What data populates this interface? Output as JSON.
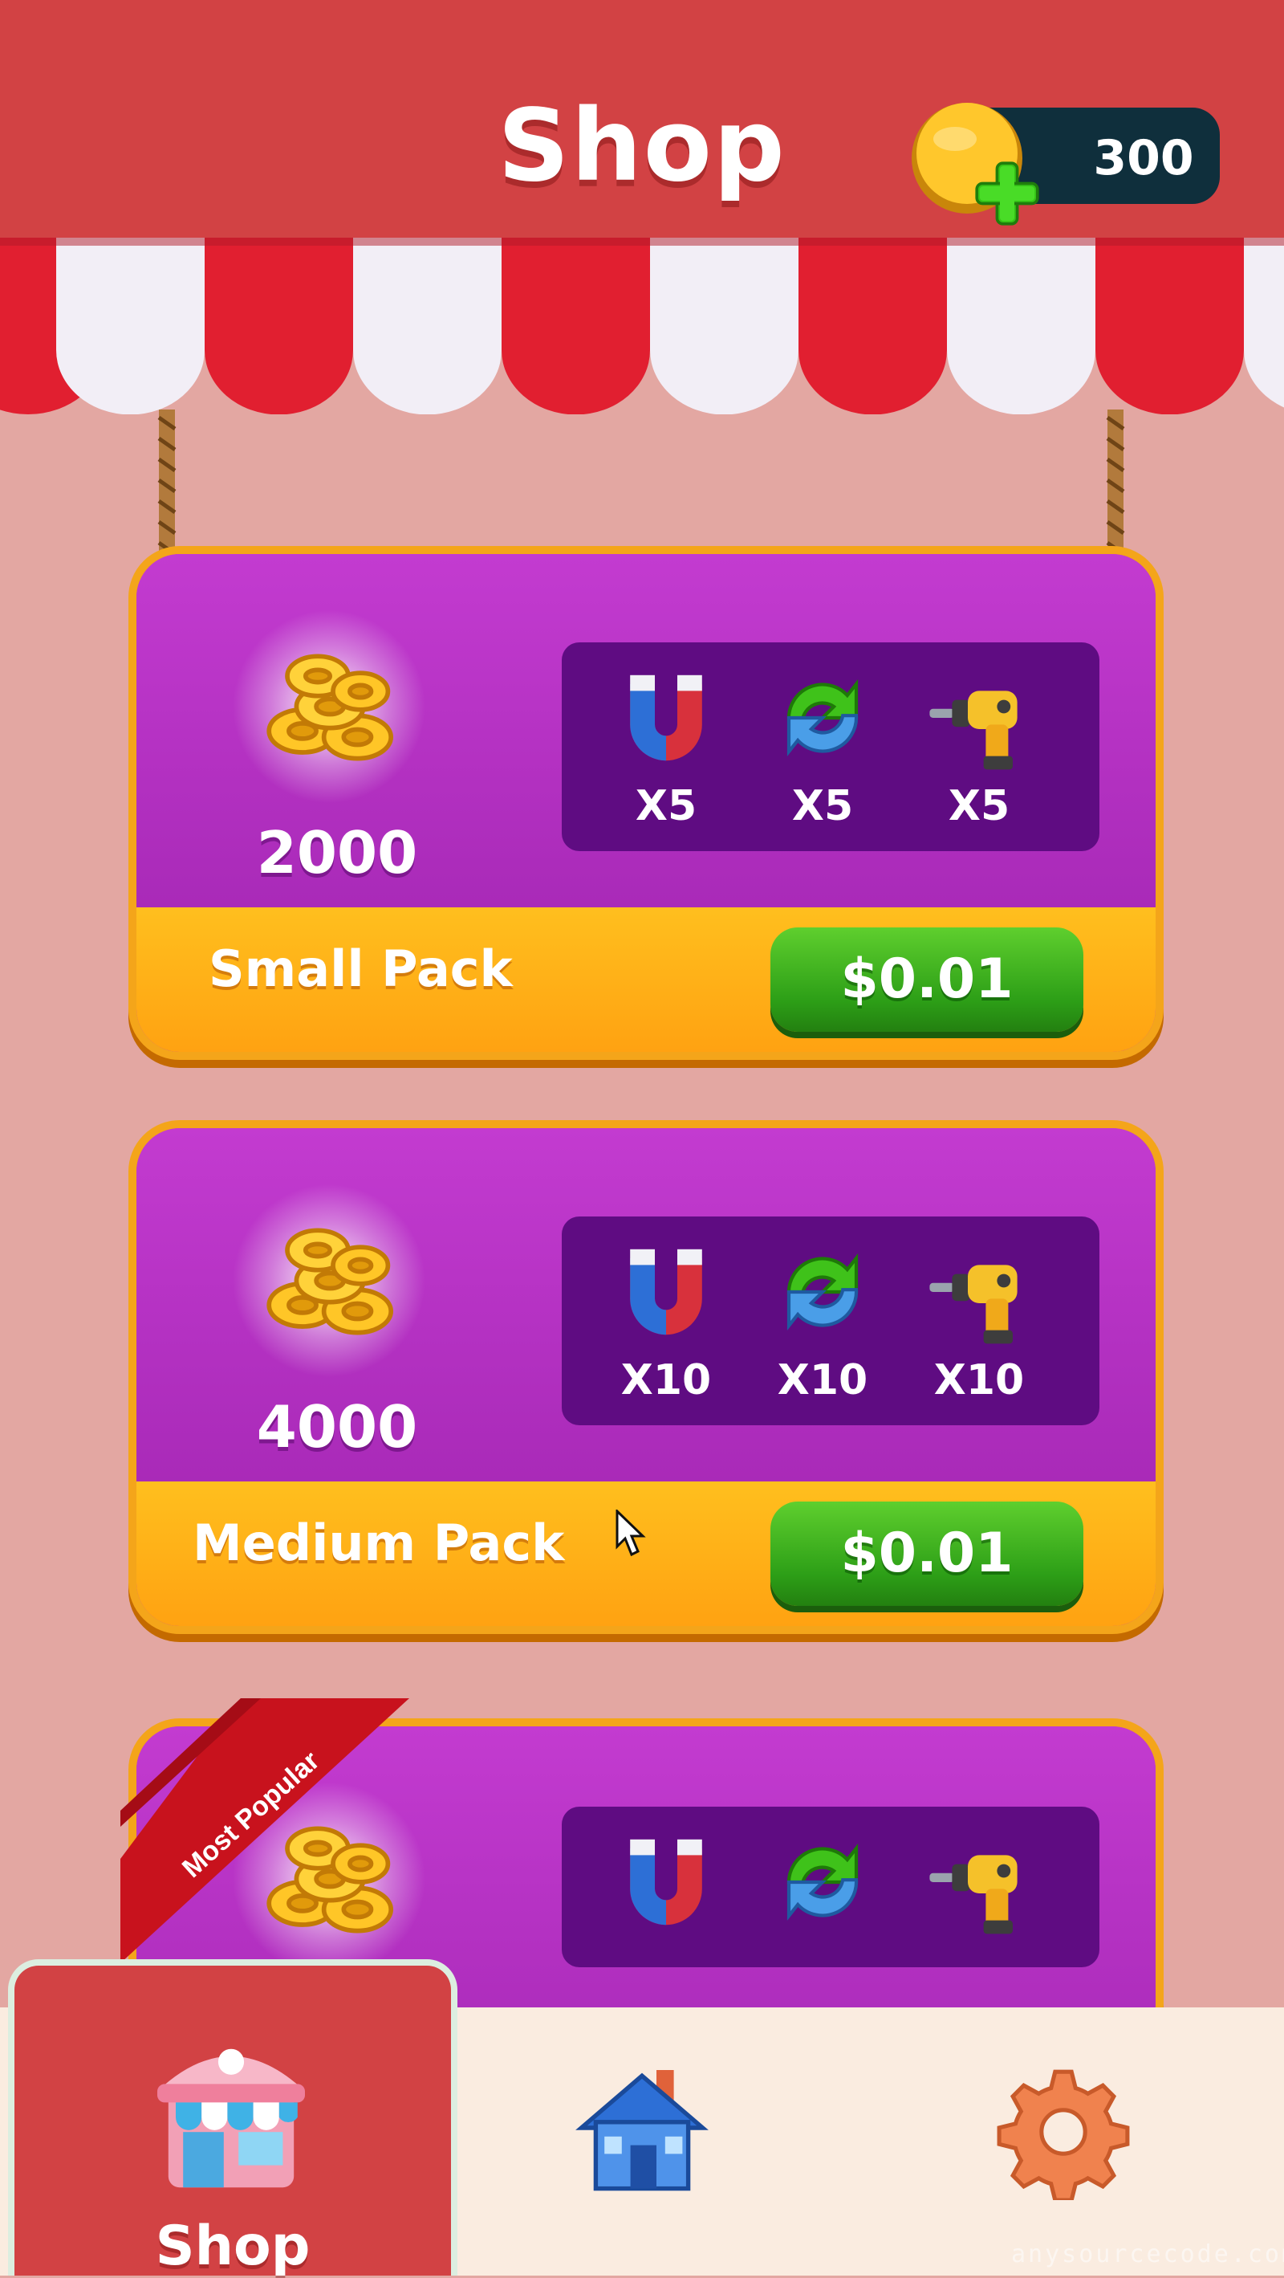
{
  "header": {
    "title": "Shop",
    "coin_balance": "300",
    "coin_icon": "coin-icon",
    "add_icon": "plus-icon"
  },
  "packs": [
    {
      "coins": "2000",
      "items": [
        {
          "icon": "magnet-icon",
          "qty": "X5"
        },
        {
          "icon": "shuffle-icon",
          "qty": "X5"
        },
        {
          "icon": "drill-icon",
          "qty": "X5"
        }
      ],
      "name": "Small Pack",
      "price": "$0.01"
    },
    {
      "coins": "4000",
      "items": [
        {
          "icon": "magnet-icon",
          "qty": "X10"
        },
        {
          "icon": "shuffle-icon",
          "qty": "X10"
        },
        {
          "icon": "drill-icon",
          "qty": "X10"
        }
      ],
      "name": "Medium Pack",
      "price": "$0.01"
    },
    {
      "badge": "Most Popular",
      "items": [
        {
          "icon": "magnet-icon"
        },
        {
          "icon": "shuffle-icon"
        },
        {
          "icon": "drill-icon"
        }
      ]
    }
  ],
  "tabs": [
    {
      "label": "Shop",
      "icon": "shop-icon",
      "active": true
    },
    {
      "icon": "home-icon"
    },
    {
      "icon": "gear-icon"
    }
  ],
  "watermark": "anysourcecode.com",
  "colors": {
    "header": "#d24244",
    "background": "#e3a7a2",
    "card": "#b933c6",
    "items_box": "#5f0c82",
    "card_footer": "#ffb01a",
    "price_button": "#2d9f17",
    "tabbar": "#faece0"
  }
}
